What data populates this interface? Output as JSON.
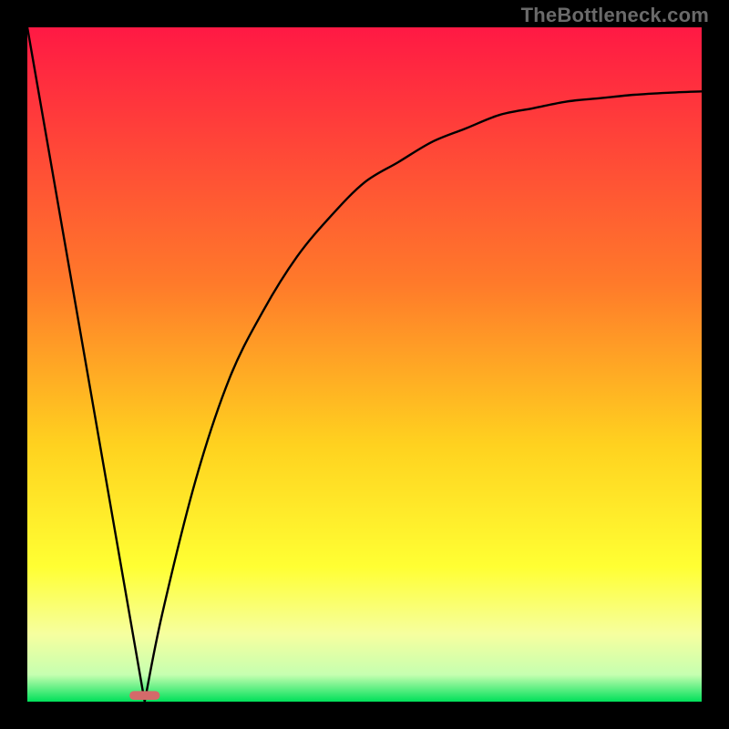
{
  "watermark": "TheBottleneck.com",
  "colors": {
    "frame": "#000000",
    "gradient_top": "#ff1944",
    "gradient_mid1": "#ff7a2a",
    "gradient_mid2": "#ffd21f",
    "gradient_mid3": "#ffff33",
    "gradient_mid4": "#f6ff9f",
    "gradient_mid5": "#c6ffb0",
    "gradient_bottom": "#00e05a",
    "curve": "#000000",
    "marker": "#d46a6a"
  },
  "chart_data": {
    "type": "line",
    "title": "",
    "xlabel": "",
    "ylabel": "",
    "x": [
      0.0,
      0.05,
      0.1,
      0.15,
      0.174,
      0.2,
      0.25,
      0.3,
      0.35,
      0.4,
      0.45,
      0.5,
      0.55,
      0.6,
      0.65,
      0.7,
      0.75,
      0.8,
      0.85,
      0.9,
      0.95,
      1.0
    ],
    "values": [
      1.0,
      0.71,
      0.42,
      0.14,
      0.0,
      0.13,
      0.33,
      0.48,
      0.58,
      0.66,
      0.72,
      0.77,
      0.8,
      0.83,
      0.85,
      0.87,
      0.88,
      0.89,
      0.895,
      0.9,
      0.903,
      0.905
    ],
    "xlim": [
      0,
      1
    ],
    "ylim": [
      0,
      1
    ],
    "minimum_x": 0.174,
    "marker": {
      "x": 0.174,
      "width": 0.045,
      "height": 0.013
    },
    "note": "axis values are normalized fractions of plot area; y is inverted (0 at bottom)"
  }
}
